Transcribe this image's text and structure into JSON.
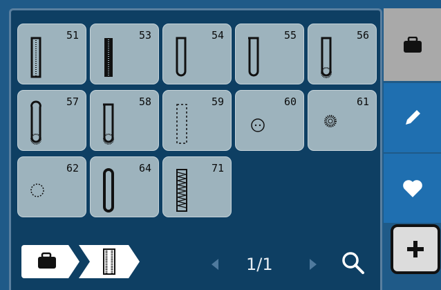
{
  "stitches": [
    {
      "number": "51",
      "icon": "buttonhole-bar-icon"
    },
    {
      "number": "53",
      "icon": "buttonhole-dense-icon"
    },
    {
      "number": "54",
      "icon": "buttonhole-rounded-icon"
    },
    {
      "number": "55",
      "icon": "buttonhole-rounded-icon"
    },
    {
      "number": "56",
      "icon": "buttonhole-rounded-icon"
    },
    {
      "number": "57",
      "icon": "buttonhole-keyhole-icon"
    },
    {
      "number": "58",
      "icon": "buttonhole-keyhole-icon"
    },
    {
      "number": "59",
      "icon": "buttonhole-dotted-icon"
    },
    {
      "number": "60",
      "icon": "button-sew-icon"
    },
    {
      "number": "61",
      "icon": "eyelet-icon"
    },
    {
      "number": "62",
      "icon": "dotted-circle-icon"
    },
    {
      "number": "64",
      "icon": "buttonhole-oval-icon"
    },
    {
      "number": "71",
      "icon": "buttonhole-zigzag-icon"
    }
  ],
  "sidebar": {
    "tabs": [
      {
        "name": "folder-tab",
        "icon": "folder-icon"
      },
      {
        "name": "edit-tab",
        "icon": "pencil-icon"
      },
      {
        "name": "favorites-tab",
        "icon": "heart-icon"
      }
    ],
    "add_icon": "plus-icon"
  },
  "pager": {
    "page": "1/1"
  },
  "colors": {
    "accent": "#1f6fb0",
    "tile": "#9db3bd",
    "panel": "#0e3f63"
  }
}
